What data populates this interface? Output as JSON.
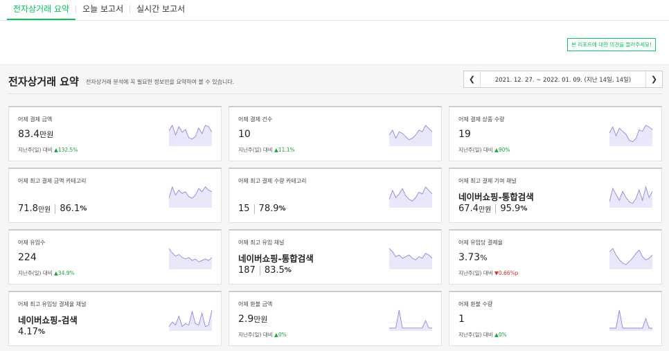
{
  "nav": {
    "tabs": [
      {
        "label": "전자상거래 요약"
      },
      {
        "label": "오늘 보고서"
      },
      {
        "label": "실시간 보고서"
      }
    ]
  },
  "banner": {
    "feedback_label": "본 리포트에 대한 의견을 들려주세요!"
  },
  "summary": {
    "title": "전자상거래 요약",
    "description": "전자상거래 분석에 꼭 필요한 정보만을 요약하여 볼 수 있습니다.",
    "date_range": "2021. 12. 27. ~ 2022. 01. 09. (지난 14일, 14일)",
    "prev_icon": "chevron-left-icon",
    "next_icon": "chevron-right-icon"
  },
  "colors": {
    "accent": "#03c75a",
    "up": "#15a83b",
    "down": "#e0282a",
    "spark_fill": "#e9e8fb",
    "spark_line": "#8b87e0"
  },
  "cards": [
    {
      "label": "어제 결제 금액",
      "value": "83.4",
      "unit": "만원",
      "comp": "지난주(일) 대비",
      "dir": "up",
      "delta": "132.5%",
      "spark": [
        10,
        14,
        7,
        13,
        9,
        11,
        5,
        4,
        6,
        12,
        8,
        14,
        13,
        9
      ]
    },
    {
      "label": "어제 결제 건수",
      "value": "10",
      "unit": "",
      "comp": "지난주(일) 대비",
      "dir": "up",
      "delta": "11.1%",
      "spark": [
        6,
        9,
        4,
        8,
        7,
        5,
        3,
        4,
        6,
        9,
        8,
        12,
        10,
        8
      ]
    },
    {
      "label": "어제 결제 상품 수량",
      "value": "19",
      "unit": "",
      "comp": "지난주(일) 대비",
      "dir": "up",
      "delta": "90%",
      "spark": [
        8,
        12,
        6,
        11,
        9,
        7,
        3,
        2,
        4,
        10,
        9,
        13,
        12,
        10
      ]
    },
    {
      "label": "어제 최고 결제 금액 카테고리",
      "value_a": "71.8",
      "unit_a": "만원",
      "value_b": "86.1",
      "unit_b": "%",
      "spark": [
        5,
        12,
        7,
        10,
        8,
        9,
        6,
        5,
        7,
        11,
        9,
        12,
        10,
        9
      ]
    },
    {
      "label": "어제 최고 결제 수량 카테고리",
      "value_a": "15",
      "unit_a": "",
      "value_b": "78.9",
      "unit_b": "%",
      "spark": [
        4,
        9,
        5,
        7,
        10,
        6,
        4,
        3,
        5,
        8,
        7,
        11,
        9,
        7
      ]
    },
    {
      "label": "어제 최고 결제 기여 채널",
      "channel": "네이버쇼핑-통합검색",
      "value_a": "67.4",
      "unit_a": "만원",
      "value_b": "95.9",
      "unit_b": "%",
      "spark": [
        3,
        12,
        8,
        4,
        10,
        6,
        3,
        2,
        5,
        11,
        4,
        13,
        6,
        10
      ]
    },
    {
      "label": "어제 유입수",
      "value": "224",
      "unit": "",
      "comp": "지난주(일) 대비",
      "dir": "up",
      "delta": "34.9%",
      "spark": [
        13,
        10,
        8,
        9,
        7,
        6,
        7,
        5,
        6,
        4,
        5,
        6,
        5,
        7
      ]
    },
    {
      "label": "어제 최고 유입 채널",
      "channel": "네이버쇼핑-통합검색",
      "value_a": "187",
      "unit_a": "",
      "value_b": "83.5",
      "unit_b": "%",
      "spark": [
        12,
        10,
        7,
        8,
        6,
        7,
        8,
        6,
        5,
        7,
        6,
        9,
        8,
        6
      ]
    },
    {
      "label": "어제 유입당 결제율",
      "value": "3.73",
      "unit": "%",
      "comp": "지난주(일) 대비",
      "dir": "down",
      "delta": "0.66%p",
      "spark": [
        10,
        12,
        8,
        5,
        3,
        2,
        4,
        6,
        9,
        11,
        7,
        5,
        6,
        8
      ]
    },
    {
      "label": "어제 최고 유입당 결제율 채널",
      "channel": "네이버쇼핑-검색",
      "value_a": "4.17",
      "unit_a": "%",
      "value_b": "",
      "unit_b": "",
      "spark": [
        2,
        5,
        3,
        9,
        2,
        4,
        3,
        12,
        4,
        3,
        11,
        2,
        3,
        13
      ]
    },
    {
      "label": "어제 환불 금액",
      "value": "2.9",
      "unit": "만원",
      "comp": "지난주(일) 대비",
      "dir": "up",
      "delta": "0%",
      "spark": [
        1,
        1,
        1,
        13,
        1,
        1,
        1,
        1,
        1,
        1,
        1,
        6,
        1,
        1
      ]
    },
    {
      "label": "어제 환불 수량",
      "value": "1",
      "unit": "",
      "comp": "지난주(일) 대비",
      "dir": "up",
      "delta": "0%",
      "spark": [
        1,
        1,
        1,
        14,
        1,
        1,
        1,
        1,
        1,
        1,
        1,
        8,
        1,
        1
      ]
    }
  ]
}
